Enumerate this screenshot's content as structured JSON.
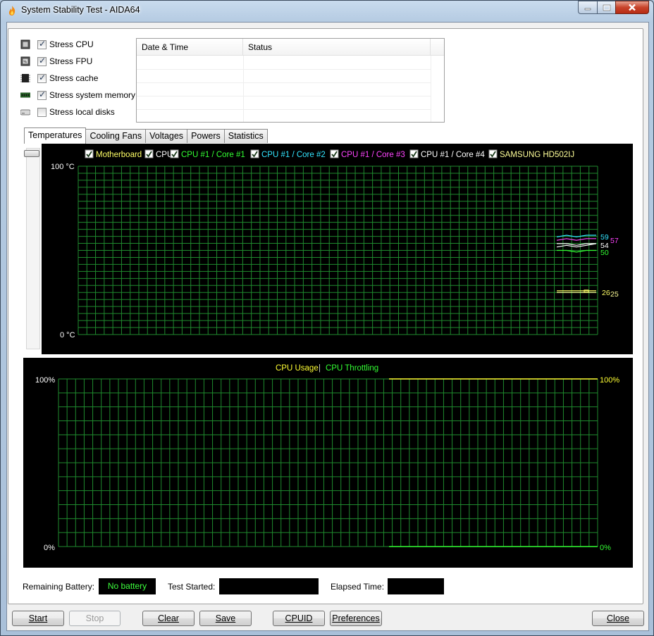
{
  "window": {
    "title": "System Stability Test - AIDA64"
  },
  "stress_options": [
    {
      "label": "Stress CPU",
      "checked": true,
      "icon": "cpu-chip-icon"
    },
    {
      "label": "Stress FPU",
      "checked": true,
      "icon": "fpu-chip-icon"
    },
    {
      "label": "Stress cache",
      "checked": true,
      "icon": "cache-chip-icon"
    },
    {
      "label": "Stress system memory",
      "checked": true,
      "icon": "memory-module-icon"
    },
    {
      "label": "Stress local disks",
      "checked": false,
      "icon": "disk-drive-icon"
    }
  ],
  "log_table": {
    "columns": [
      "Date & Time",
      "Status"
    ],
    "rows": []
  },
  "tabs": [
    "Temperatures",
    "Cooling Fans",
    "Voltages",
    "Powers",
    "Statistics"
  ],
  "active_tab": "Temperatures",
  "temperature_chart": {
    "legend": [
      {
        "label": "Motherboard",
        "color": "#ffff66",
        "checked": true
      },
      {
        "label": "CPU",
        "color": "#ffffff",
        "checked": true
      },
      {
        "label": "CPU #1 / Core #1",
        "color": "#33ff33",
        "checked": true
      },
      {
        "label": "CPU #1 / Core #2",
        "color": "#33e5ff",
        "checked": true
      },
      {
        "label": "CPU #1 / Core #3",
        "color": "#ff44ff",
        "checked": true
      },
      {
        "label": "CPU #1 / Core #4",
        "color": "#ffffff",
        "checked": true
      },
      {
        "label": "SAMSUNG HD502IJ",
        "color": "#ffff99",
        "checked": true
      }
    ],
    "y_top_label": "100 °C",
    "y_bottom_label": "0 °C",
    "end_values": [
      {
        "text": "59",
        "color": "#33e5ff"
      },
      {
        "text": "57",
        "color": "#ff44ff"
      },
      {
        "text": "54",
        "color": "#ffffff"
      },
      {
        "text": "50",
        "color": "#33ff33"
      },
      {
        "text": "26",
        "color": "#ffff66"
      },
      {
        "text": "25",
        "color": "#ffff99"
      }
    ]
  },
  "usage_chart": {
    "title_left": "CPU Usage",
    "separator": "|",
    "title_right": "CPU Throttling",
    "title_left_color": "#ffff33",
    "title_right_color": "#33ff33",
    "y_top_label": "100%",
    "y_bottom_label": "0%",
    "right_top_label": "100%",
    "right_bottom_label": "0%"
  },
  "chart_data": [
    {
      "type": "line",
      "ylabel": "",
      "ylim": [
        0,
        100
      ],
      "y_unit": "°C",
      "grid": true,
      "legend_placement": "top",
      "series": [
        {
          "name": "Motherboard",
          "values": [
            26,
            26,
            26,
            26,
            26
          ]
        },
        {
          "name": "CPU",
          "values": [
            54,
            54,
            53,
            54,
            54
          ]
        },
        {
          "name": "CPU #1 / Core #1",
          "values": [
            50,
            50,
            49,
            50,
            50
          ]
        },
        {
          "name": "CPU #1 / Core #2",
          "values": [
            58,
            59,
            58,
            59,
            59
          ]
        },
        {
          "name": "CPU #1 / Core #3",
          "values": [
            56,
            57,
            56,
            57,
            57
          ]
        },
        {
          "name": "CPU #1 / Core #4",
          "values": [
            52,
            53,
            52,
            53,
            54
          ]
        },
        {
          "name": "SAMSUNG HD502IJ",
          "values": [
            25,
            25,
            25,
            25,
            25
          ]
        }
      ]
    },
    {
      "type": "line",
      "ylim": [
        0,
        100
      ],
      "y_unit": "%",
      "grid": true,
      "legend_placement": "top",
      "series": [
        {
          "name": "CPU Usage",
          "values": [
            100,
            100
          ]
        },
        {
          "name": "CPU Throttling",
          "values": [
            0,
            0
          ]
        }
      ]
    }
  ],
  "status_bar": {
    "battery_label": "Remaining Battery:",
    "battery_value": "No battery",
    "started_label": "Test Started:",
    "started_value": "",
    "elapsed_label": "Elapsed Time:",
    "elapsed_value": ""
  },
  "buttons": {
    "start": "Start",
    "stop": "Stop",
    "clear": "Clear",
    "save": "Save",
    "cpuid": "CPUID",
    "preferences": "Preferences",
    "close": "Close"
  }
}
